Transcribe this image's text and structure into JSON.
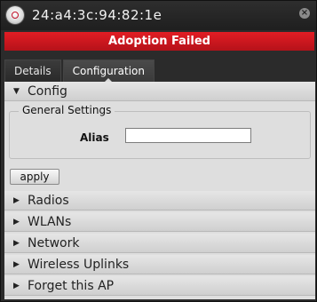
{
  "header": {
    "mac_address": "24:a4:3c:94:82:1e",
    "close_glyph": "×"
  },
  "alert": {
    "text": "Adoption Failed",
    "color": "#d0151d"
  },
  "tabs": [
    {
      "label": "Details",
      "active": false
    },
    {
      "label": "Configuration",
      "active": true
    }
  ],
  "config": {
    "section_label": "Config",
    "expanded": true,
    "general_settings": {
      "legend": "General Settings",
      "alias_label": "Alias",
      "alias_value": ""
    },
    "apply_label": "apply"
  },
  "sections": [
    {
      "label": "Radios"
    },
    {
      "label": "WLANs"
    },
    {
      "label": "Network"
    },
    {
      "label": "Wireless Uplinks"
    },
    {
      "label": "Forget this AP"
    }
  ],
  "icons": {
    "expanded": "▼",
    "collapsed": "▶"
  }
}
